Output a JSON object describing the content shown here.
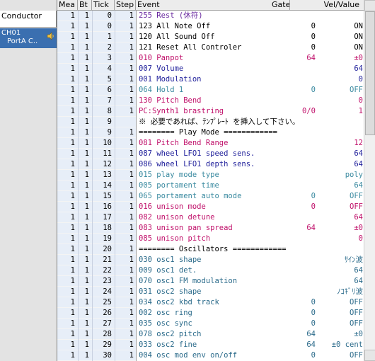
{
  "tracks": {
    "conductor_label": "Conductor",
    "ch01_line1": "CH01",
    "ch01_line2": "PortA C.."
  },
  "columns": {
    "mea": "Mea",
    "bt": "Bt",
    "tick": "Tick",
    "step": "Step",
    "event": "Event",
    "gate": "Gate",
    "vel": "Vel/Value"
  },
  "rows": [
    {
      "mea": "1",
      "bt": "1",
      "tick": "0",
      "step": "1",
      "event": "255 Rest (休符)",
      "gate": "",
      "val": "",
      "color": "purple"
    },
    {
      "mea": "1",
      "bt": "1",
      "tick": "0",
      "step": "1",
      "event": "123 All Note Off",
      "gate": "0",
      "val": "ON",
      "color": "black"
    },
    {
      "mea": "1",
      "bt": "1",
      "tick": "1",
      "step": "1",
      "event": "120 All Sound Off",
      "gate": "0",
      "val": "ON",
      "color": "black"
    },
    {
      "mea": "1",
      "bt": "1",
      "tick": "2",
      "step": "1",
      "event": "121 Reset All Controler",
      "gate": "0",
      "val": "ON",
      "color": "black"
    },
    {
      "mea": "1",
      "bt": "1",
      "tick": "3",
      "step": "1",
      "event": "010 Panpot",
      "gate": "64",
      "val": "±0",
      "color": "mag"
    },
    {
      "mea": "1",
      "bt": "1",
      "tick": "4",
      "step": "1",
      "event": "007 Volume",
      "gate": "",
      "val": "64",
      "color": "blue"
    },
    {
      "mea": "1",
      "bt": "1",
      "tick": "5",
      "step": "1",
      "event": "001 Modulation",
      "gate": "",
      "val": "0",
      "color": "blue"
    },
    {
      "mea": "1",
      "bt": "1",
      "tick": "6",
      "step": "1",
      "event": "064 Hold 1",
      "gate": "0",
      "val": "OFF",
      "color": "teal"
    },
    {
      "mea": "1",
      "bt": "1",
      "tick": "7",
      "step": "1",
      "event": "130 Pitch Bend",
      "gate": "",
      "val": "0",
      "color": "mag"
    },
    {
      "mea": "1",
      "bt": "1",
      "tick": "8",
      "step": "1",
      "event": "PC:Synth1 brastring",
      "gate": "0/0",
      "val": "1",
      "color": "mag"
    },
    {
      "mea": "1",
      "bt": "1",
      "tick": "9",
      "step": "",
      "event": "※ 必要であれば、ﾃﾝﾌﾟﾚｰﾄ を挿入して下さい。",
      "gate": "",
      "val": "",
      "color": "black"
    },
    {
      "mea": "1",
      "bt": "1",
      "tick": "9",
      "step": "1",
      "event": "======== Play Mode ============",
      "gate": "",
      "val": "",
      "color": "black"
    },
    {
      "mea": "1",
      "bt": "1",
      "tick": "10",
      "step": "1",
      "event": "081 Pitch Bend Range",
      "gate": "",
      "val": "12",
      "color": "mag"
    },
    {
      "mea": "1",
      "bt": "1",
      "tick": "11",
      "step": "1",
      "event": "087 wheel LFO1 speed sens.",
      "gate": "",
      "val": "64",
      "color": "blue"
    },
    {
      "mea": "1",
      "bt": "1",
      "tick": "12",
      "step": "1",
      "event": "086 wheel LFO1 depth sens.",
      "gate": "",
      "val": "64",
      "color": "blue"
    },
    {
      "mea": "1",
      "bt": "1",
      "tick": "13",
      "step": "1",
      "event": "015 play mode type",
      "gate": "",
      "val": "poly",
      "color": "teal"
    },
    {
      "mea": "1",
      "bt": "1",
      "tick": "14",
      "step": "1",
      "event": "005 portament time",
      "gate": "",
      "val": "64",
      "color": "teal"
    },
    {
      "mea": "1",
      "bt": "1",
      "tick": "15",
      "step": "1",
      "event": "065 portament auto mode",
      "gate": "0",
      "val": "OFF",
      "color": "teal"
    },
    {
      "mea": "1",
      "bt": "1",
      "tick": "16",
      "step": "1",
      "event": "016 unison mode",
      "gate": "0",
      "val": "OFF",
      "color": "mag"
    },
    {
      "mea": "1",
      "bt": "1",
      "tick": "17",
      "step": "1",
      "event": "082 unison detune",
      "gate": "",
      "val": "64",
      "color": "mag"
    },
    {
      "mea": "1",
      "bt": "1",
      "tick": "18",
      "step": "1",
      "event": "083 unison pan spread",
      "gate": "64",
      "val": "±0",
      "color": "mag"
    },
    {
      "mea": "1",
      "bt": "1",
      "tick": "19",
      "step": "1",
      "event": "085 unison pitch",
      "gate": "",
      "val": "0",
      "color": "mag"
    },
    {
      "mea": "1",
      "bt": "1",
      "tick": "20",
      "step": "1",
      "event": "======== Oscillators ============",
      "gate": "",
      "val": "",
      "color": "black"
    },
    {
      "mea": "1",
      "bt": "1",
      "tick": "21",
      "step": "1",
      "event": "030 osc1 shape",
      "gate": "",
      "val": "ｻｲﾝ波",
      "color": "darkteal"
    },
    {
      "mea": "1",
      "bt": "1",
      "tick": "22",
      "step": "1",
      "event": "009 osc1 det.",
      "gate": "",
      "val": "64",
      "color": "darkteal"
    },
    {
      "mea": "1",
      "bt": "1",
      "tick": "23",
      "step": "1",
      "event": "070 osc1 FM modulation",
      "gate": "",
      "val": "64",
      "color": "darkteal"
    },
    {
      "mea": "1",
      "bt": "1",
      "tick": "24",
      "step": "1",
      "event": "031 osc2 shape",
      "gate": "",
      "val": "ﾉｺｷﾞﾘ波",
      "color": "darkteal"
    },
    {
      "mea": "1",
      "bt": "1",
      "tick": "25",
      "step": "1",
      "event": "034 osc2 kbd track",
      "gate": "0",
      "val": "OFF",
      "color": "darkteal"
    },
    {
      "mea": "1",
      "bt": "1",
      "tick": "26",
      "step": "1",
      "event": "002 osc ring",
      "gate": "0",
      "val": "OFF",
      "color": "darkteal"
    },
    {
      "mea": "1",
      "bt": "1",
      "tick": "27",
      "step": "1",
      "event": "035 osc sync",
      "gate": "0",
      "val": "OFF",
      "color": "darkteal"
    },
    {
      "mea": "1",
      "bt": "1",
      "tick": "28",
      "step": "1",
      "event": "078 osc2 pitch",
      "gate": "64",
      "val": "±0",
      "color": "darkteal"
    },
    {
      "mea": "1",
      "bt": "1",
      "tick": "29",
      "step": "1",
      "event": "033 osc2 fine",
      "gate": "64",
      "val": "±0 cent",
      "color": "darkteal"
    },
    {
      "mea": "1",
      "bt": "1",
      "tick": "30",
      "step": "1",
      "event": "004 osc mod env on/off",
      "gate": "0",
      "val": "OFF",
      "color": "darkteal"
    }
  ],
  "colors": {
    "black": "#000000",
    "mag": "#c0106a",
    "blue": "#1e1e9a",
    "teal": "#3a8aa0",
    "darkteal": "#2a6a8a",
    "purple": "#6a2aa0",
    "selected_track_bg": "#3a6fb0"
  }
}
